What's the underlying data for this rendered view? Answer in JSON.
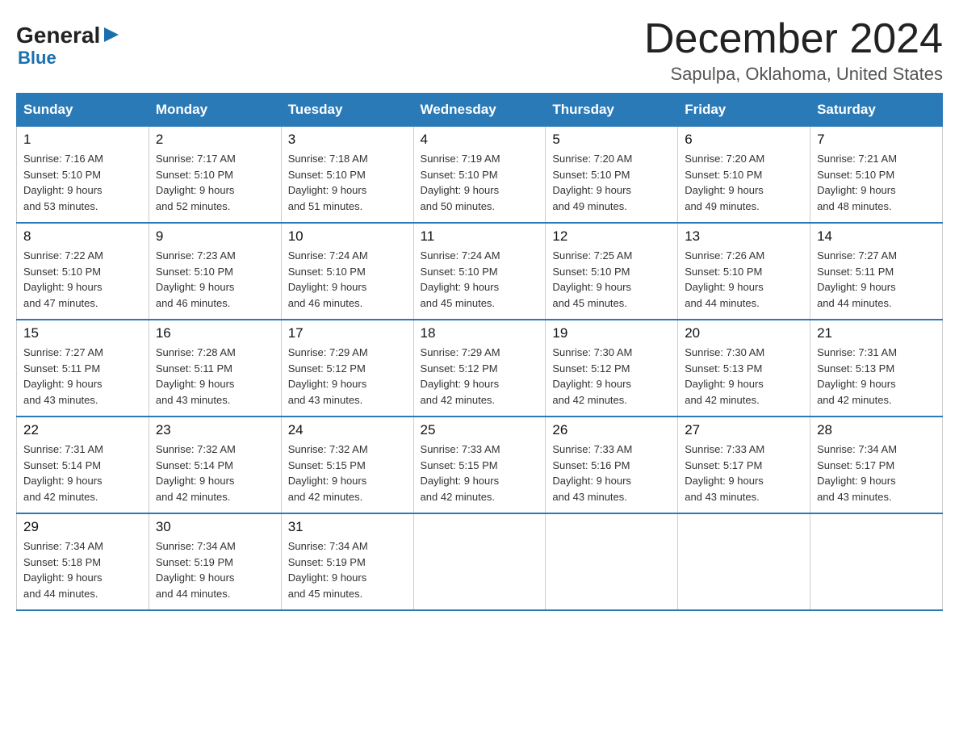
{
  "header": {
    "logo_general": "General",
    "logo_blue": "Blue",
    "title": "December 2024",
    "subtitle": "Sapulpa, Oklahoma, United States"
  },
  "days_of_week": [
    "Sunday",
    "Monday",
    "Tuesday",
    "Wednesday",
    "Thursday",
    "Friday",
    "Saturday"
  ],
  "weeks": [
    [
      {
        "day": "1",
        "info": "Sunrise: 7:16 AM\nSunset: 5:10 PM\nDaylight: 9 hours\nand 53 minutes."
      },
      {
        "day": "2",
        "info": "Sunrise: 7:17 AM\nSunset: 5:10 PM\nDaylight: 9 hours\nand 52 minutes."
      },
      {
        "day": "3",
        "info": "Sunrise: 7:18 AM\nSunset: 5:10 PM\nDaylight: 9 hours\nand 51 minutes."
      },
      {
        "day": "4",
        "info": "Sunrise: 7:19 AM\nSunset: 5:10 PM\nDaylight: 9 hours\nand 50 minutes."
      },
      {
        "day": "5",
        "info": "Sunrise: 7:20 AM\nSunset: 5:10 PM\nDaylight: 9 hours\nand 49 minutes."
      },
      {
        "day": "6",
        "info": "Sunrise: 7:20 AM\nSunset: 5:10 PM\nDaylight: 9 hours\nand 49 minutes."
      },
      {
        "day": "7",
        "info": "Sunrise: 7:21 AM\nSunset: 5:10 PM\nDaylight: 9 hours\nand 48 minutes."
      }
    ],
    [
      {
        "day": "8",
        "info": "Sunrise: 7:22 AM\nSunset: 5:10 PM\nDaylight: 9 hours\nand 47 minutes."
      },
      {
        "day": "9",
        "info": "Sunrise: 7:23 AM\nSunset: 5:10 PM\nDaylight: 9 hours\nand 46 minutes."
      },
      {
        "day": "10",
        "info": "Sunrise: 7:24 AM\nSunset: 5:10 PM\nDaylight: 9 hours\nand 46 minutes."
      },
      {
        "day": "11",
        "info": "Sunrise: 7:24 AM\nSunset: 5:10 PM\nDaylight: 9 hours\nand 45 minutes."
      },
      {
        "day": "12",
        "info": "Sunrise: 7:25 AM\nSunset: 5:10 PM\nDaylight: 9 hours\nand 45 minutes."
      },
      {
        "day": "13",
        "info": "Sunrise: 7:26 AM\nSunset: 5:10 PM\nDaylight: 9 hours\nand 44 minutes."
      },
      {
        "day": "14",
        "info": "Sunrise: 7:27 AM\nSunset: 5:11 PM\nDaylight: 9 hours\nand 44 minutes."
      }
    ],
    [
      {
        "day": "15",
        "info": "Sunrise: 7:27 AM\nSunset: 5:11 PM\nDaylight: 9 hours\nand 43 minutes."
      },
      {
        "day": "16",
        "info": "Sunrise: 7:28 AM\nSunset: 5:11 PM\nDaylight: 9 hours\nand 43 minutes."
      },
      {
        "day": "17",
        "info": "Sunrise: 7:29 AM\nSunset: 5:12 PM\nDaylight: 9 hours\nand 43 minutes."
      },
      {
        "day": "18",
        "info": "Sunrise: 7:29 AM\nSunset: 5:12 PM\nDaylight: 9 hours\nand 42 minutes."
      },
      {
        "day": "19",
        "info": "Sunrise: 7:30 AM\nSunset: 5:12 PM\nDaylight: 9 hours\nand 42 minutes."
      },
      {
        "day": "20",
        "info": "Sunrise: 7:30 AM\nSunset: 5:13 PM\nDaylight: 9 hours\nand 42 minutes."
      },
      {
        "day": "21",
        "info": "Sunrise: 7:31 AM\nSunset: 5:13 PM\nDaylight: 9 hours\nand 42 minutes."
      }
    ],
    [
      {
        "day": "22",
        "info": "Sunrise: 7:31 AM\nSunset: 5:14 PM\nDaylight: 9 hours\nand 42 minutes."
      },
      {
        "day": "23",
        "info": "Sunrise: 7:32 AM\nSunset: 5:14 PM\nDaylight: 9 hours\nand 42 minutes."
      },
      {
        "day": "24",
        "info": "Sunrise: 7:32 AM\nSunset: 5:15 PM\nDaylight: 9 hours\nand 42 minutes."
      },
      {
        "day": "25",
        "info": "Sunrise: 7:33 AM\nSunset: 5:15 PM\nDaylight: 9 hours\nand 42 minutes."
      },
      {
        "day": "26",
        "info": "Sunrise: 7:33 AM\nSunset: 5:16 PM\nDaylight: 9 hours\nand 43 minutes."
      },
      {
        "day": "27",
        "info": "Sunrise: 7:33 AM\nSunset: 5:17 PM\nDaylight: 9 hours\nand 43 minutes."
      },
      {
        "day": "28",
        "info": "Sunrise: 7:34 AM\nSunset: 5:17 PM\nDaylight: 9 hours\nand 43 minutes."
      }
    ],
    [
      {
        "day": "29",
        "info": "Sunrise: 7:34 AM\nSunset: 5:18 PM\nDaylight: 9 hours\nand 44 minutes."
      },
      {
        "day": "30",
        "info": "Sunrise: 7:34 AM\nSunset: 5:19 PM\nDaylight: 9 hours\nand 44 minutes."
      },
      {
        "day": "31",
        "info": "Sunrise: 7:34 AM\nSunset: 5:19 PM\nDaylight: 9 hours\nand 45 minutes."
      },
      {
        "day": "",
        "info": ""
      },
      {
        "day": "",
        "info": ""
      },
      {
        "day": "",
        "info": ""
      },
      {
        "day": "",
        "info": ""
      }
    ]
  ]
}
